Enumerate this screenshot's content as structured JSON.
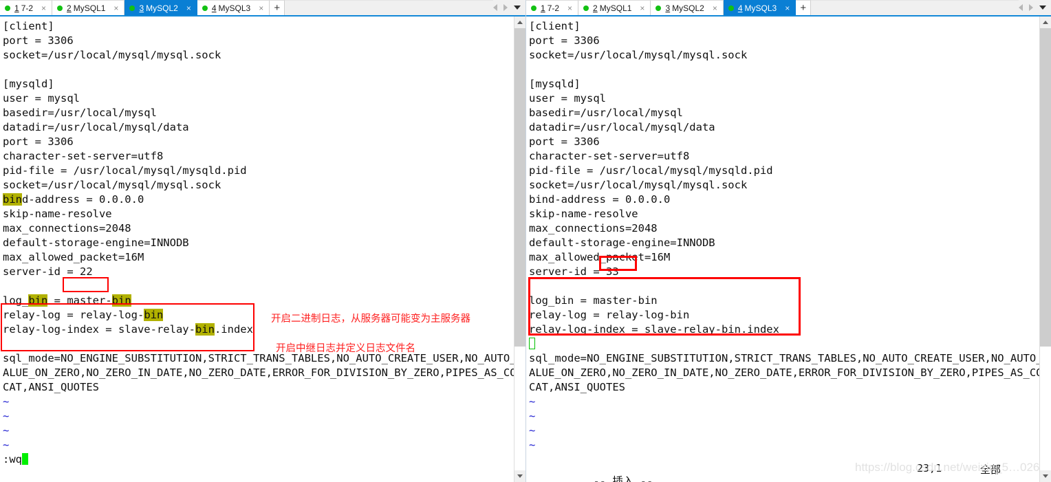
{
  "colors": {
    "accent": "#0a7fd4",
    "tab_dot": "#13c113",
    "annotation_red": "#fe0000",
    "note_red": "#fe2020",
    "search_highlight": "#b2b200",
    "cursor_green": "#00ef00",
    "tilde_blue": "#1a1ad0"
  },
  "left_pane": {
    "tabbar": {
      "tabs": [
        {
          "num": "1",
          "label": "7-2",
          "active": false,
          "close": "×",
          "status_dot": "green"
        },
        {
          "num": "2",
          "label": "MySQL1",
          "active": false,
          "close": "×",
          "status_dot": "green"
        },
        {
          "num": "3",
          "label": "MySQL2",
          "active": true,
          "close": "×",
          "status_dot": "green"
        },
        {
          "num": "4",
          "label": "MySQL3",
          "active": false,
          "close": "×",
          "status_dot": "green"
        }
      ],
      "add_label": "+",
      "nav_prev_icon": "arrow-left-icon",
      "nav_next_icon": "arrow-right-icon",
      "menu_icon": "chevron-down-icon"
    },
    "terminal": {
      "lines": [
        {
          "text": "[client]"
        },
        {
          "text": "port = 3306"
        },
        {
          "text": "socket=/usr/local/mysql/mysql.sock"
        },
        {
          "text": ""
        },
        {
          "text": "[mysqld]"
        },
        {
          "text": "user = mysql"
        },
        {
          "text": "basedir=/usr/local/mysql"
        },
        {
          "text": "datadir=/usr/local/mysql/data"
        },
        {
          "text": "port = 3306"
        },
        {
          "text": "character-set-server=utf8"
        },
        {
          "text": "pid-file = /usr/local/mysql/mysqld.pid"
        },
        {
          "text": "socket=/usr/local/mysql/mysql.sock"
        },
        {
          "text": "bind-address = 0.0.0.0",
          "highlight": "bin"
        },
        {
          "text": "skip-name-resolve"
        },
        {
          "text": "max_connections=2048"
        },
        {
          "text": "default-storage-engine=INNODB"
        },
        {
          "text": "max_allowed_packet=16M"
        },
        {
          "text": "server-id = 22"
        },
        {
          "text": ""
        },
        {
          "text": "log_bin = master-bin",
          "highlight": "bin"
        },
        {
          "text": "relay-log = relay-log-bin",
          "highlight": "bin"
        },
        {
          "text": "relay-log-index = slave-relay-bin.index",
          "highlight": "bin"
        },
        {
          "text": ""
        },
        {
          "text": "sql_mode=NO_ENGINE_SUBSTITUTION,STRICT_TRANS_TABLES,NO_AUTO_CREATE_USER,NO_AUTO_V"
        },
        {
          "text": "ALUE_ON_ZERO,NO_ZERO_IN_DATE,NO_ZERO_DATE,ERROR_FOR_DIVISION_BY_ZERO,PIPES_AS_CON"
        },
        {
          "text": "CAT,ANSI_QUOTES"
        },
        {
          "text": "~",
          "tilde": true
        },
        {
          "text": "~",
          "tilde": true
        },
        {
          "text": "~",
          "tilde": true
        },
        {
          "text": "~",
          "tilde": true
        }
      ],
      "command_line": ":wq",
      "cursor": "block"
    },
    "annotations": {
      "note1": "开启二进制日志，从服务器可能变为主服务器",
      "note2": "开启中继日志并定义日志文件名",
      "box_serverid_label": "server-id-value-box",
      "box_logbin_label": "log-bin-block-box"
    }
  },
  "right_pane": {
    "tabbar": {
      "tabs": [
        {
          "num": "1",
          "label": "7-2",
          "active": false,
          "close": "×",
          "status_dot": "green"
        },
        {
          "num": "2",
          "label": "MySQL1",
          "active": false,
          "close": "×",
          "status_dot": "green"
        },
        {
          "num": "3",
          "label": "MySQL2",
          "active": false,
          "close": "×",
          "status_dot": "green"
        },
        {
          "num": "4",
          "label": "MySQL3",
          "active": true,
          "close": "×",
          "status_dot": "green"
        }
      ],
      "add_label": "+",
      "nav_prev_icon": "arrow-left-icon",
      "nav_next_icon": "arrow-right-icon",
      "menu_icon": "chevron-down-icon"
    },
    "terminal": {
      "lines": [
        {
          "text": "[client]"
        },
        {
          "text": "port = 3306"
        },
        {
          "text": "socket=/usr/local/mysql/mysql.sock"
        },
        {
          "text": ""
        },
        {
          "text": "[mysqld]"
        },
        {
          "text": "user = mysql"
        },
        {
          "text": "basedir=/usr/local/mysql"
        },
        {
          "text": "datadir=/usr/local/mysql/data"
        },
        {
          "text": "port = 3306"
        },
        {
          "text": "character-set-server=utf8"
        },
        {
          "text": "pid-file = /usr/local/mysql/mysqld.pid"
        },
        {
          "text": "socket=/usr/local/mysql/mysql.sock"
        },
        {
          "text": "bind-address = 0.0.0.0"
        },
        {
          "text": "skip-name-resolve"
        },
        {
          "text": "max_connections=2048"
        },
        {
          "text": "default-storage-engine=INNODB"
        },
        {
          "text": "max_allowed_packet=16M"
        },
        {
          "text": "server-id = 33"
        },
        {
          "text": ""
        },
        {
          "text": "log_bin = master-bin"
        },
        {
          "text": "relay-log = relay-log-bin"
        },
        {
          "text": "relay-log-index = slave-relay-bin.index"
        },
        {
          "text": "",
          "cursor": "hollow"
        },
        {
          "text": "sql_mode=NO_ENGINE_SUBSTITUTION,STRICT_TRANS_TABLES,NO_AUTO_CREATE_USER,NO_AUTO_V"
        },
        {
          "text": "ALUE_ON_ZERO,NO_ZERO_IN_DATE,NO_ZERO_DATE,ERROR_FOR_DIVISION_BY_ZERO,PIPES_AS_CON"
        },
        {
          "text": "CAT,ANSI_QUOTES"
        },
        {
          "text": "~",
          "tilde": true
        },
        {
          "text": "~",
          "tilde": true
        },
        {
          "text": "~",
          "tilde": true
        },
        {
          "text": "~",
          "tilde": true
        }
      ],
      "status_mode": "-- 插入 --",
      "status_position": "23,1",
      "status_scroll": "全部"
    },
    "annotations": {
      "box_serverid_label": "server-id-value-box",
      "box_logbin_label": "log-bin-block-box"
    },
    "watermark": "https://blog.csdn.net/weixin_5…026"
  }
}
